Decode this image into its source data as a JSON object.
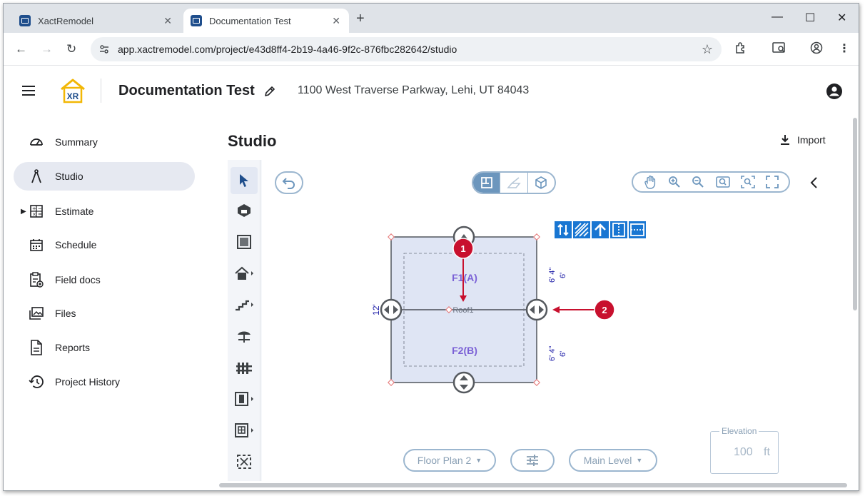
{
  "browser": {
    "tabs": [
      {
        "label": "XactRemodel",
        "active": false
      },
      {
        "label": "Documentation Test",
        "active": true
      }
    ],
    "url": "app.xactremodel.com/project/e43d8ff4-2b19-4a46-9f2c-876fbc282642/studio"
  },
  "header": {
    "logo_text": "XR",
    "project_title": "Documentation Test",
    "address": "1100 West Traverse Parkway, Lehi, UT 84043"
  },
  "sidebar": {
    "items": [
      {
        "label": "Summary",
        "icon": "speedometer-icon",
        "active": false
      },
      {
        "label": "Studio",
        "icon": "compass-icon",
        "active": true
      },
      {
        "label": "Estimate",
        "icon": "calculator-icon",
        "active": false,
        "expandable": true
      },
      {
        "label": "Schedule",
        "icon": "calendar-icon",
        "active": false
      },
      {
        "label": "Field docs",
        "icon": "clipboard-add-icon",
        "active": false
      },
      {
        "label": "Files",
        "icon": "images-icon",
        "active": false
      },
      {
        "label": "Reports",
        "icon": "document-icon",
        "active": false
      },
      {
        "label": "Project History",
        "icon": "history-icon",
        "active": false
      }
    ]
  },
  "studio": {
    "title": "Studio",
    "import_label": "Import",
    "floor_plan_select": "Floor Plan 2",
    "level_select": "Main Level",
    "elevation": {
      "label": "Elevation",
      "value": "100",
      "unit": "ft"
    },
    "plan": {
      "rooms": [
        "F1(A)",
        "F2(B)"
      ],
      "roof_label": "Roof1",
      "dimension_left": "12'",
      "dimension_top_right": "6' 4\"",
      "dimension_top_right_inner": "6'",
      "dimension_bottom_right": "6' 4\"",
      "dimension_bottom_right_inner": "6'",
      "callouts": [
        "1",
        "2"
      ]
    },
    "colors": {
      "accent": "#6c96bd",
      "room_fill": "#dfe5f4",
      "room_label": "#7b61d6",
      "callout": "#c8102e",
      "toolbar_icon": "#1976d2"
    }
  }
}
